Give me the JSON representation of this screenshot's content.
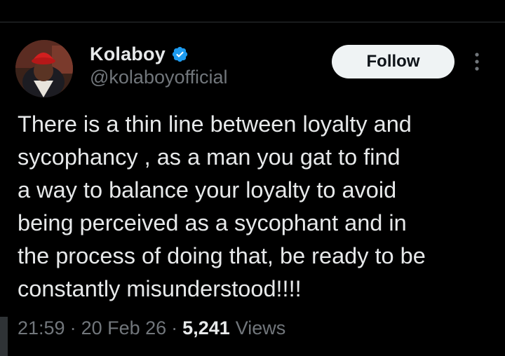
{
  "colors": {
    "background": "#000000",
    "primary_text": "#e7e9ea",
    "secondary_text": "#71767b",
    "verified": "#1d9bf0",
    "follow_button_bg": "#eff3f4"
  },
  "author": {
    "display_name": "Kolaboy",
    "handle": "@kolaboyofficial",
    "verified_icon": "verified-badge-icon",
    "avatar_icon": "profile-photo"
  },
  "actions": {
    "follow_label": "Follow",
    "more_icon": "more-vertical-icon"
  },
  "tweet": {
    "lines": [
      "There is a thin line between loyalty and",
      "sycophancy , as a man you gat to find",
      "a way to balance your loyalty to avoid",
      "being perceived as a sycophant and in",
      "the process of doing that, be ready to be",
      "constantly misunderstood!!!!"
    ]
  },
  "meta": {
    "time": "21:59",
    "separator": "·",
    "date": "20 Feb 26",
    "views_count": "5,241",
    "views_label": "Views"
  }
}
